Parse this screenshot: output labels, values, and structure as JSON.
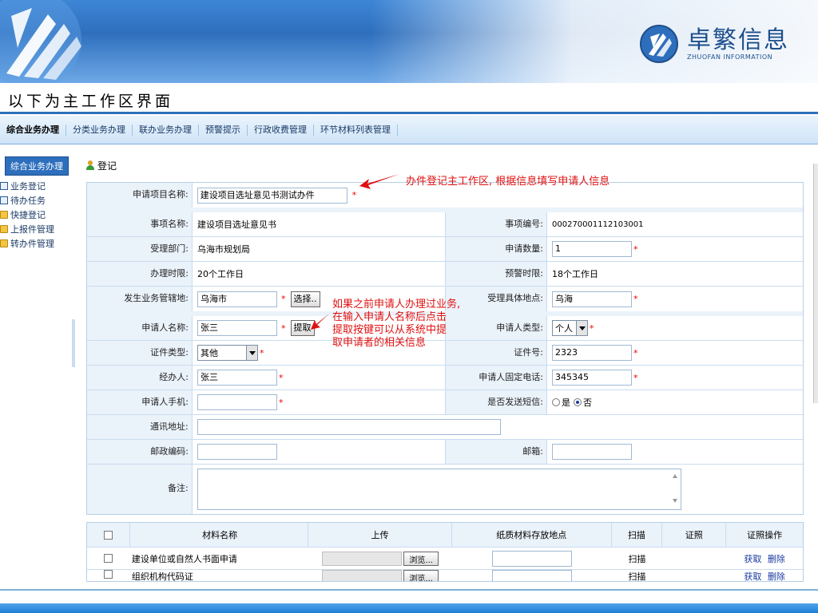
{
  "brand": {
    "name_cn": "卓繁信息",
    "name_en": "ZHUOFAN INFORMATION"
  },
  "caption": "以下为主工作区界面",
  "nav": [
    "综合业务办理",
    "分类业务办理",
    "联办业务办理",
    "预警提示",
    "行政收费管理",
    "环节材料列表管理"
  ],
  "sidebar": {
    "header": "综合业务办理",
    "items": [
      "业务登记",
      "待办任务",
      "快捷登记",
      "上报件管理",
      "转办件管理"
    ]
  },
  "register_title": "登记",
  "form": {
    "item_name_label": "申请项目名称:",
    "item_name_value": "建设项目选址意见书测试办件",
    "matter_name_label": "事项名称:",
    "matter_name_value": "建设项目选址意见书",
    "matter_no_label": "事项编号:",
    "matter_no_value": "000270001112103001",
    "dept_label": "受理部门:",
    "dept_value": "乌海市规划局",
    "qty_label": "申请数量:",
    "qty_value": "1",
    "limit_label": "办理时限:",
    "limit_value": "20个工作日",
    "warn_label": "预警时限:",
    "warn_value": "18个工作日",
    "region_label": "发生业务管辖地:",
    "region_value": "乌海市",
    "select_btn": "选择..",
    "place_label": "受理具体地点:",
    "place_value": "乌海",
    "applicant_label": "申请人名称:",
    "applicant_value": "张三",
    "fetch_btn": "提取",
    "type_label": "申请人类型:",
    "type_value": "个人",
    "cert_type_label": "证件类型:",
    "cert_type_value": "其他",
    "cert_no_label": "证件号:",
    "cert_no_value": "2323",
    "agent_label": "经办人:",
    "agent_value": "张三",
    "phone_label": "申请人固定电话:",
    "phone_value": "345345",
    "mobile_label": "申请人手机:",
    "sms_label": "是否发送短信:",
    "sms_yes": "是",
    "sms_no": "否",
    "address_label": "通讯地址:",
    "zip_label": "邮政编码:",
    "email_label": "邮箱:",
    "remark_label": "备注:"
  },
  "annotations": {
    "note1": "办件登记主工作区, 根据信息填写申请人信息",
    "note2": [
      "如果之前申请人办理过业务,",
      "在输入申请人名称后点击",
      "提取按键可以从系统中提",
      "取申请者的相关信息"
    ]
  },
  "materials": {
    "headers": [
      "材料名称",
      "上传",
      "纸质材料存放地点",
      "扫描",
      "证照",
      "证照操作"
    ],
    "rows": [
      {
        "name": "建设单位或自然人书面申请",
        "browse": "浏览...",
        "scan": "扫描",
        "op_get": "获取",
        "op_del": "删除"
      },
      {
        "name": "组织机构代码证",
        "browse": "浏览...",
        "scan": "扫描",
        "op_get": "获取",
        "op_del": "删除"
      }
    ]
  },
  "colors": {
    "accent": "#2e6fbd",
    "label_bg": "#eaf2fa",
    "required": "#e00000",
    "annotation": "#e01010"
  }
}
